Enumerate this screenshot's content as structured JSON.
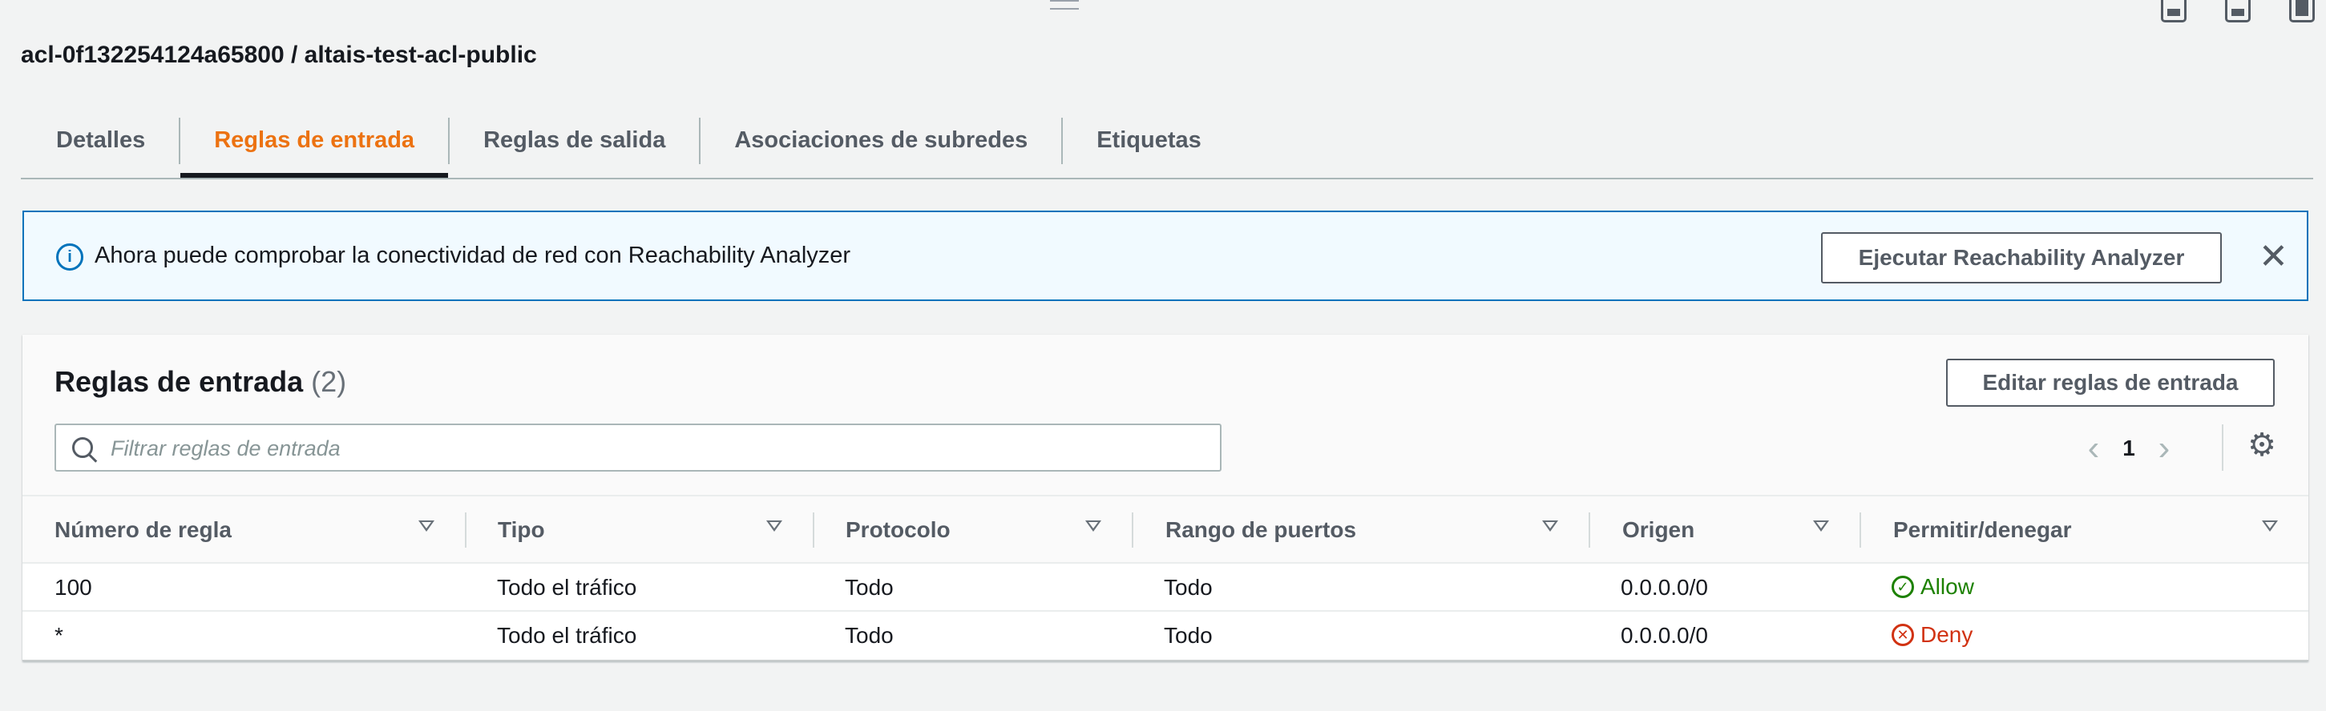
{
  "window": {
    "title": "acl-0f132254124a65800 / altais-test-acl-public"
  },
  "tabs": [
    {
      "label": "Detalles"
    },
    {
      "label": "Reglas de entrada"
    },
    {
      "label": "Reglas de salida"
    },
    {
      "label": "Asociaciones de subredes"
    },
    {
      "label": "Etiquetas"
    }
  ],
  "active_tab": "Reglas de entrada",
  "banner": {
    "text": "Ahora puede comprobar la conectividad de red con Reachability Analyzer",
    "button_label": "Ejecutar Reachability Analyzer",
    "close_glyph": "✕"
  },
  "panel": {
    "title": "Reglas de entrada",
    "count": "(2)",
    "edit_button": "Editar reglas de entrada",
    "search_placeholder": "Filtrar reglas de entrada",
    "page": "1",
    "prev_glyph": "‹",
    "next_glyph": "›",
    "gear_glyph": "⚙"
  },
  "table": {
    "columns": [
      "Número de regla",
      "Tipo",
      "Protocolo",
      "Rango de puertos",
      "Origen",
      "Permitir/denegar"
    ],
    "rows": [
      {
        "rule": "100",
        "type": "Todo el tráfico",
        "protocol": "Todo",
        "ports": "Todo",
        "source": "0.0.0.0/0",
        "action": "Allow",
        "action_glyph": "✓"
      },
      {
        "rule": "*",
        "type": "Todo el tráfico",
        "protocol": "Todo",
        "ports": "Todo",
        "source": "0.0.0.0/0",
        "action": "Deny",
        "action_glyph": "✕"
      }
    ]
  },
  "colors": {
    "accent": "#ec7211",
    "info": "#0073bb",
    "allow": "#1d8102",
    "deny": "#d13212"
  }
}
